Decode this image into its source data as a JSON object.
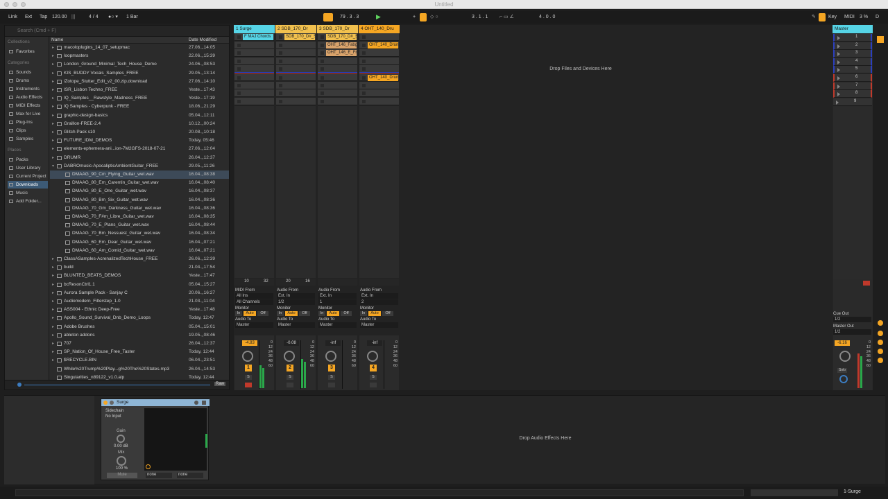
{
  "window": {
    "title": "Untitled"
  },
  "control_bar": {
    "link": "Link",
    "ext": "Ext",
    "tap": "Tap",
    "tempo": "120.00",
    "signature": "4 / 4",
    "metro": "1 Bar",
    "position": "79 .  3 .  3",
    "loop_start": "3 .  1 .  1",
    "loop_length": "4 .  0 .  0",
    "key": "Key",
    "midi": "MIDI",
    "cpu": "3 %",
    "disk": "D"
  },
  "browser": {
    "search_placeholder": "Search (Cmd + F)",
    "collections_header": "Collections",
    "collections": [
      "Favorites"
    ],
    "categories_header": "Categories",
    "categories": [
      "Sounds",
      "Drums",
      "Instruments",
      "Audio Effects",
      "MIDI Effects",
      "Max for Live",
      "Plug-Ins",
      "Clips",
      "Samples"
    ],
    "places_header": "Places",
    "places": [
      "Packs",
      "User Library",
      "Current Project",
      "Downloads",
      "Music",
      "Add Folder..."
    ],
    "selected_place": "Downloads",
    "col_name": "Name",
    "col_date": "Date Modified",
    "raw_label": "Raw",
    "files": [
      {
        "name": "macoloplugins_14_07_setupmac",
        "date": "27.06.,,14:05",
        "type": "folder",
        "indent": 0
      },
      {
        "name": "loopmasters",
        "date": "22.06.,,15:39",
        "type": "folder",
        "indent": 0
      },
      {
        "name": "London_Ground_Minimal_Tech_House_Demo",
        "date": "24.06.,,08:53",
        "type": "folder",
        "indent": 0
      },
      {
        "name": "KIS_BUDDY Vocals_Samples_FREE",
        "date": "29.05.,,13:14",
        "type": "folder",
        "indent": 0
      },
      {
        "name": "iZotope_Stutter_Edit_v2_00.zip.download",
        "date": "27.06.,,14:10",
        "type": "folder",
        "indent": 0
      },
      {
        "name": "ISR_Lisbon Techno_FREE",
        "date": "Yeste...17:43",
        "type": "folder",
        "indent": 0
      },
      {
        "name": "IQ_Samples__Rawstyle_Madness_FREE",
        "date": "Yeste...17:19",
        "type": "folder",
        "indent": 0
      },
      {
        "name": "IQ Samples - Cyberpunk - FREE",
        "date": "18.06.,,21:29",
        "type": "folder",
        "indent": 0
      },
      {
        "name": "graphic-design-basics",
        "date": "05.04.,,12:11",
        "type": "folder",
        "indent": 0
      },
      {
        "name": "Graillon-FREE-2.4",
        "date": "10.12.,,00:24",
        "type": "folder",
        "indent": 0
      },
      {
        "name": "Glitch Pack s10",
        "date": "20.08.,,10:18",
        "type": "folder",
        "indent": 0
      },
      {
        "name": "FUTURE_IDM_DEMOS",
        "date": "Today, 05:46",
        "type": "folder",
        "indent": 0
      },
      {
        "name": "elements-ephemera-ani...ion-7M2GFS-2018-07-21",
        "date": "27.06.,,12:04",
        "type": "folder",
        "indent": 0
      },
      {
        "name": "DRUMR",
        "date": "26.04.,,12:37",
        "type": "folder",
        "indent": 0
      },
      {
        "name": "DABROmusic-ApocalipticAmbientGuitar_FREE",
        "date": "29.05.,,11:26",
        "type": "folder",
        "indent": 0,
        "open": true
      },
      {
        "name": "DMAAG_90_Cm_Flying_Guitar_wet.wav",
        "date": "16.04.,,08:38",
        "type": "audio",
        "indent": 1,
        "selected": true
      },
      {
        "name": "DMAAG_80_Em_Carentin_Guitar_wet.wav",
        "date": "16.04.,,08:40",
        "type": "audio",
        "indent": 1
      },
      {
        "name": "DMAAG_80_E_One_Guitar_wet.wav",
        "date": "16.04.,,08:37",
        "type": "audio",
        "indent": 1
      },
      {
        "name": "DMAAG_80_Bm_Six_Guitar_wet.wav",
        "date": "16.04.,,08:36",
        "type": "audio",
        "indent": 1
      },
      {
        "name": "DMAAG_70_Gm_Darkness_Guitar_wet.wav",
        "date": "16.04.,,08:36",
        "type": "audio",
        "indent": 1
      },
      {
        "name": "DMAAG_70_F#m_Libre_Guitar_wet.wav",
        "date": "16.04.,,08:35",
        "type": "audio",
        "indent": 1
      },
      {
        "name": "DMAAG_70_E_Plans_Guitar_wet.wav",
        "date": "16.04.,,08:44",
        "type": "audio",
        "indent": 1
      },
      {
        "name": "DMAAG_70_Bm_Nessuest_Guitar_wet.wav",
        "date": "16.04.,,08:34",
        "type": "audio",
        "indent": 1
      },
      {
        "name": "DMAAG_60_Em_Dear_Guitar_wet.wav",
        "date": "16.04.,,07:21",
        "type": "audio",
        "indent": 1
      },
      {
        "name": "DMAAG_60_Am_Comid_Guitar_wet.wav",
        "date": "16.04.,,07:21",
        "type": "audio",
        "indent": 1
      },
      {
        "name": "ClassASamples-AcrenalizedTechHouse_FREE",
        "date": "26.06.,,12:39",
        "type": "folder",
        "indent": 0
      },
      {
        "name": "build",
        "date": "21.04.,,17:54",
        "type": "folder",
        "indent": 0
      },
      {
        "name": "BLUNTED_BEATS_DEMOS",
        "date": "Yeste...17:47",
        "type": "folder",
        "indent": 0
      },
      {
        "name": "bcResonCtrl1.1",
        "date": "05.04.,,15:27",
        "type": "folder",
        "indent": 0
      },
      {
        "name": "Aurora Sample Pack - Sanjay C",
        "date": "20.06.,,16:27",
        "type": "folder",
        "indent": 0
      },
      {
        "name": "Audiomodern_Filterstep_1.0",
        "date": "21.03.,,11:04",
        "type": "folder",
        "indent": 0
      },
      {
        "name": "ASS004 - Ethnic Deep-Free",
        "date": "Yeste...17:48",
        "type": "folder",
        "indent": 0
      },
      {
        "name": "Apollo_Sound_Survival_Dnb_Demo_Loops",
        "date": "Today, 12:47",
        "type": "folder",
        "indent": 0
      },
      {
        "name": "Adobe Brushes",
        "date": "05.04.,,15:01",
        "type": "folder",
        "indent": 0
      },
      {
        "name": "ableton addons",
        "date": "19.05.,,08:46",
        "type": "folder",
        "indent": 0
      },
      {
        "name": "707",
        "date": "26.04.,,12:37",
        "type": "folder",
        "indent": 0
      },
      {
        "name": "SP_Nation_Of_House_Free_Taster",
        "date": "Today, 12:44",
        "type": "folder",
        "indent": 0
      },
      {
        "name": "$RECYCLE.BIN",
        "date": "06.04.,,23:51",
        "type": "folder",
        "indent": 0
      },
      {
        "name": "While%20Trump%20Play...g%20The%20States.mp3",
        "date": "26.04.,,14:53",
        "type": "file",
        "indent": 0
      },
      {
        "name": "Singularities_n89122_v1.0.alp",
        "date": "Today, 12:44",
        "type": "file",
        "indent": 0
      }
    ]
  },
  "session": {
    "drop_text": "Drop Files and Devices Here",
    "tracks": [
      {
        "name": "1 Surge",
        "color": "#56d4e6",
        "clips": [
          {
            "slot": 0,
            "name": "F MAJ Chords",
            "color": "#56d4e6"
          }
        ],
        "io_from": "MIDI From",
        "from_src": "All Ins",
        "from_ch": "All Channels",
        "monitor": "Monitor",
        "mon": [
          "In",
          "Auto",
          "Off"
        ],
        "to": "Audio To",
        "to_dst": "Master",
        "vol": "-4.83",
        "num": "1",
        "ctrl1": "10",
        "ctrl2": "32",
        "meter": 0.55
      },
      {
        "name": "2 SDB_170_Dr",
        "color": "#f2c14e",
        "clips": [
          {
            "slot": 0,
            "name": "SDB_170_D#_S",
            "color": "#f2c14e"
          }
        ],
        "io_from": "Audio From",
        "from_src": "Ext. In",
        "from_ch": "1/2",
        "monitor": "Monitor",
        "mon": [
          "In",
          "Auto",
          "Off"
        ],
        "to": "Audio To",
        "to_dst": "Master",
        "vol": "-0.08",
        "num": "2",
        "ctrl1": "20",
        "ctrl2": "16",
        "meter": 0.7
      },
      {
        "name": "3 SDB_170_Dr",
        "color": "#f2c14e",
        "clips": [
          {
            "slot": 0,
            "name": "SDB_170_D#_S",
            "color": "#f2c14e"
          },
          {
            "slot": 1,
            "name": "OHT_146_Fabg",
            "color": "#d9a36b"
          },
          {
            "slot": 2,
            "name": "OHT_146_E_Fr",
            "color": "#d9a36b"
          }
        ],
        "io_from": "Audio From",
        "from_src": "Ext. In",
        "from_ch": "1",
        "monitor": "Monitor",
        "mon": [
          "In",
          "Auto",
          "Off"
        ],
        "to": "Audio To",
        "to_dst": "Master",
        "vol": "-inf",
        "num": "3",
        "ctrl1": "",
        "ctrl2": "",
        "meter": 0
      },
      {
        "name": "4 OHT_140_Dru",
        "color": "#f5a623",
        "clips": [
          {
            "slot": 1,
            "name": "OHT_140_Drum",
            "color": "#f5a623"
          },
          {
            "slot": 5,
            "name": "OHT_140_Drum",
            "color": "#f5a623"
          }
        ],
        "io_from": "Audio From",
        "from_src": "Ext. In",
        "from_ch": "2",
        "monitor": "Monitor",
        "mon": [
          "In",
          "Auto",
          "Off"
        ],
        "to": "Audio To",
        "to_dst": "Master",
        "vol": "-inf",
        "num": "4",
        "ctrl1": "",
        "ctrl2": "",
        "meter": 0
      }
    ],
    "scale": [
      "0",
      "12",
      "24",
      "36",
      "48",
      "60"
    ],
    "master": {
      "name": "Master",
      "scenes": [
        "1",
        "2",
        "3",
        "4",
        "5",
        "6",
        "7",
        "8",
        "9"
      ],
      "cue_out": "Cue Out",
      "cue_val": "1/2",
      "master_out": "Master Out",
      "master_val": "1/2",
      "vol": "-6.16",
      "solo": "Solo"
    }
  },
  "device": {
    "title": "Surge",
    "sidechain": "Sidechain",
    "sc_input": "No Input",
    "gain": "Gain",
    "gain_val": "0.00 dB",
    "mix": "Mix",
    "mix_val": "100 %",
    "mute": "Mute",
    "none1": "none",
    "none2": "none",
    "drop_text": "Drop Audio Effects Here"
  },
  "status": {
    "track": "1-Surge"
  },
  "colors": {
    "accent": "#f5a623",
    "selection": "#3d4a58",
    "surge": "#56d4e6"
  }
}
